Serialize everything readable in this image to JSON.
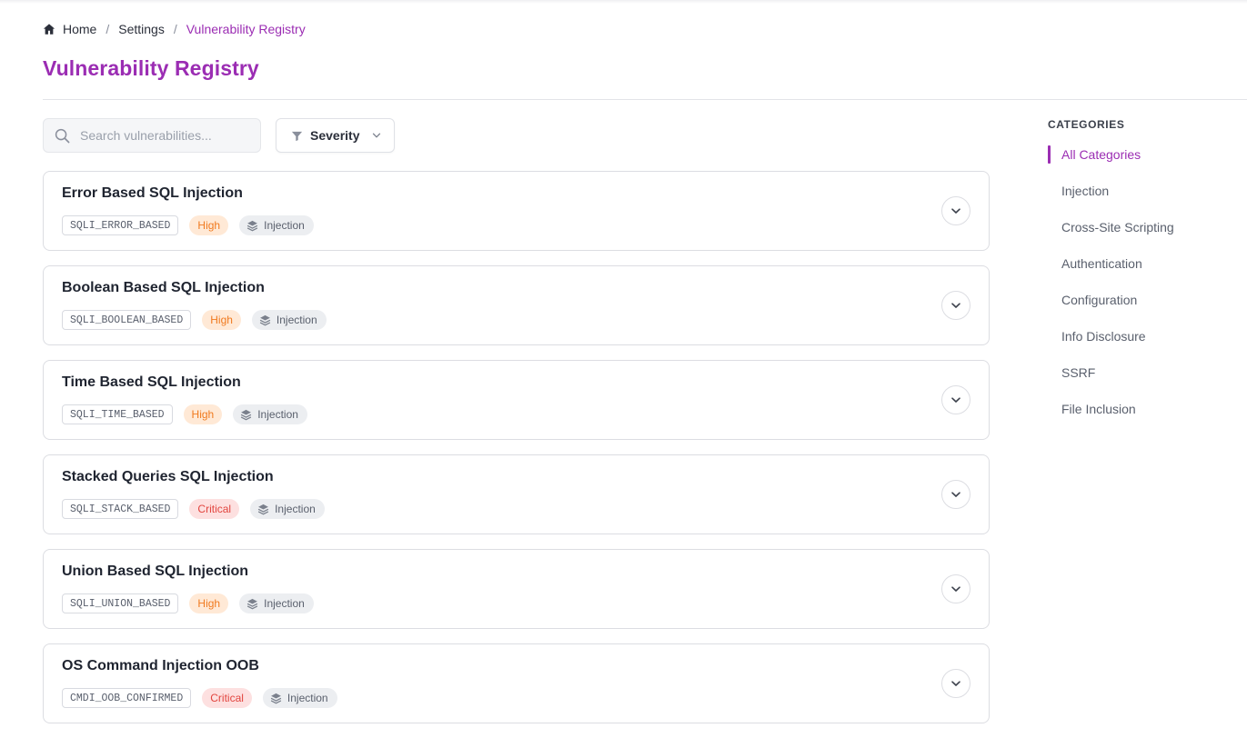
{
  "breadcrumb": {
    "home": "Home",
    "separator": "/",
    "settings": "Settings",
    "current": "Vulnerability Registry"
  },
  "page_title": "Vulnerability Registry",
  "search": {
    "placeholder": "Search vulnerabilities...",
    "value": ""
  },
  "filter": {
    "label": "Severity"
  },
  "colors": {
    "accent": "#9b2db3",
    "high_bg": "#ffe9d6",
    "high_fg": "#f07a1f",
    "critical_bg": "#fde0e0",
    "critical_fg": "#e2453f"
  },
  "vulnerabilities": [
    {
      "title": "Error Based SQL Injection",
      "code": "SQLI_ERROR_BASED",
      "severity": "High",
      "category": "Injection"
    },
    {
      "title": "Boolean Based SQL Injection",
      "code": "SQLI_BOOLEAN_BASED",
      "severity": "High",
      "category": "Injection"
    },
    {
      "title": "Time Based SQL Injection",
      "code": "SQLI_TIME_BASED",
      "severity": "High",
      "category": "Injection"
    },
    {
      "title": "Stacked Queries SQL Injection",
      "code": "SQLI_STACK_BASED",
      "severity": "Critical",
      "category": "Injection"
    },
    {
      "title": "Union Based SQL Injection",
      "code": "SQLI_UNION_BASED",
      "severity": "High",
      "category": "Injection"
    },
    {
      "title": "OS Command Injection OOB",
      "code": "CMDI_OOB_CONFIRMED",
      "severity": "Critical",
      "category": "Injection"
    }
  ],
  "sidebar": {
    "heading": "CATEGORIES",
    "items": [
      {
        "label": "All Categories",
        "active": true
      },
      {
        "label": "Injection",
        "active": false
      },
      {
        "label": "Cross-Site Scripting",
        "active": false
      },
      {
        "label": "Authentication",
        "active": false
      },
      {
        "label": "Configuration",
        "active": false
      },
      {
        "label": "Info Disclosure",
        "active": false
      },
      {
        "label": "SSRF",
        "active": false
      },
      {
        "label": "File Inclusion",
        "active": false
      }
    ]
  },
  "icons": {
    "home": "home-icon",
    "search": "search-icon",
    "filter": "filter-icon",
    "dropdown": "chevron-down-icon",
    "category": "layers-icon",
    "expand": "chevron-down-icon"
  }
}
